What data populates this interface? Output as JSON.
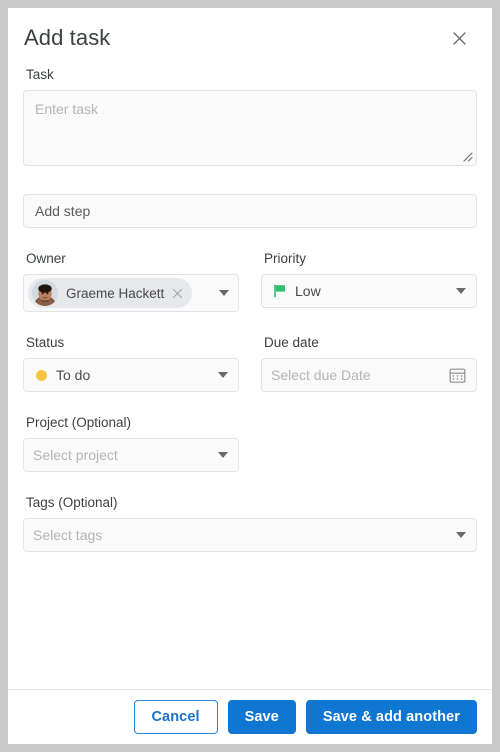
{
  "dialog": {
    "title": "Add task",
    "close_icon": "close-icon"
  },
  "fields": {
    "task": {
      "label": "Task",
      "placeholder": "Enter task",
      "value": ""
    },
    "add_step": {
      "placeholder": "Add step",
      "value": ""
    },
    "owner": {
      "label": "Owner",
      "chip_name": "Graeme Hackett",
      "remove_icon": "close-icon",
      "avatar_icon": "avatar-photo"
    },
    "priority": {
      "label": "Priority",
      "value": "Low",
      "flag_color": "#2fbf6f",
      "icon": "flag-icon"
    },
    "status": {
      "label": "Status",
      "value": "To do",
      "dot_color": "#f6c544",
      "icon": "status-dot-icon"
    },
    "due_date": {
      "label": "Due date",
      "placeholder": "Select due Date",
      "value": "",
      "icon": "calendar-icon"
    },
    "project": {
      "label": "Project (Optional)",
      "placeholder": "Select project",
      "value": ""
    },
    "tags": {
      "label": "Tags (Optional)",
      "placeholder": "Select tags",
      "value": ""
    }
  },
  "footer": {
    "cancel_label": "Cancel",
    "save_label": "Save",
    "save_add_another_label": "Save & add another",
    "primary_color": "#0f76d1",
    "outline_color": "#2a86d8"
  }
}
